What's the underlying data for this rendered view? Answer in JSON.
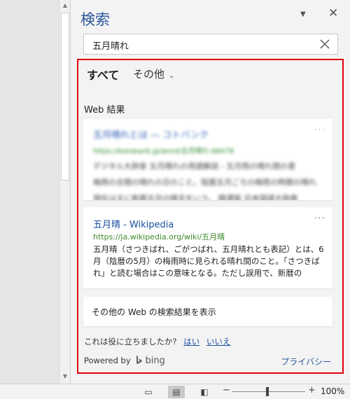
{
  "pane": {
    "title": "検索",
    "search_value": "五月晴れ"
  },
  "tabs": {
    "all": "すべて",
    "other": "その他"
  },
  "results": {
    "heading": "Web 結果",
    "blurred": {
      "title": "五月晴れとは ― コトバンク",
      "url": "https://kotobank.jp/word/五月晴れ-68478",
      "lines": [
        "デジタル大辞泉 五月晴れの用語解説 - 五月雨の晴れ間の意",
        "梅雨の合間の晴れの日のこと。陰暦五月ごろの梅雨の時期の晴れ",
        "現在は主に新暦五月の晴天をいう。 精選版 日本国語大辞典"
      ]
    },
    "wiki": {
      "title": "五月晴 - Wikipedia",
      "url": "https://ja.wikipedia.org/wiki/五月晴",
      "snippet": "五月晴（さつきばれ、ごがつばれ、五月晴れとも表記）とは、6月（陰暦の5月）の梅雨時に見られる晴れ間のこと。「さつきばれ」と読む場合はこの意味となる。ただし誤用で、新暦の"
    },
    "more_web": "その他の Web の検索結果を表示"
  },
  "feedback": {
    "question": "これは役に立ちましたか?",
    "yes": "はい",
    "no": "いいえ"
  },
  "footer": {
    "powered_by": "Powered by",
    "bing": "bing",
    "privacy": "プライバシー"
  },
  "status": {
    "zoom": "100%"
  }
}
